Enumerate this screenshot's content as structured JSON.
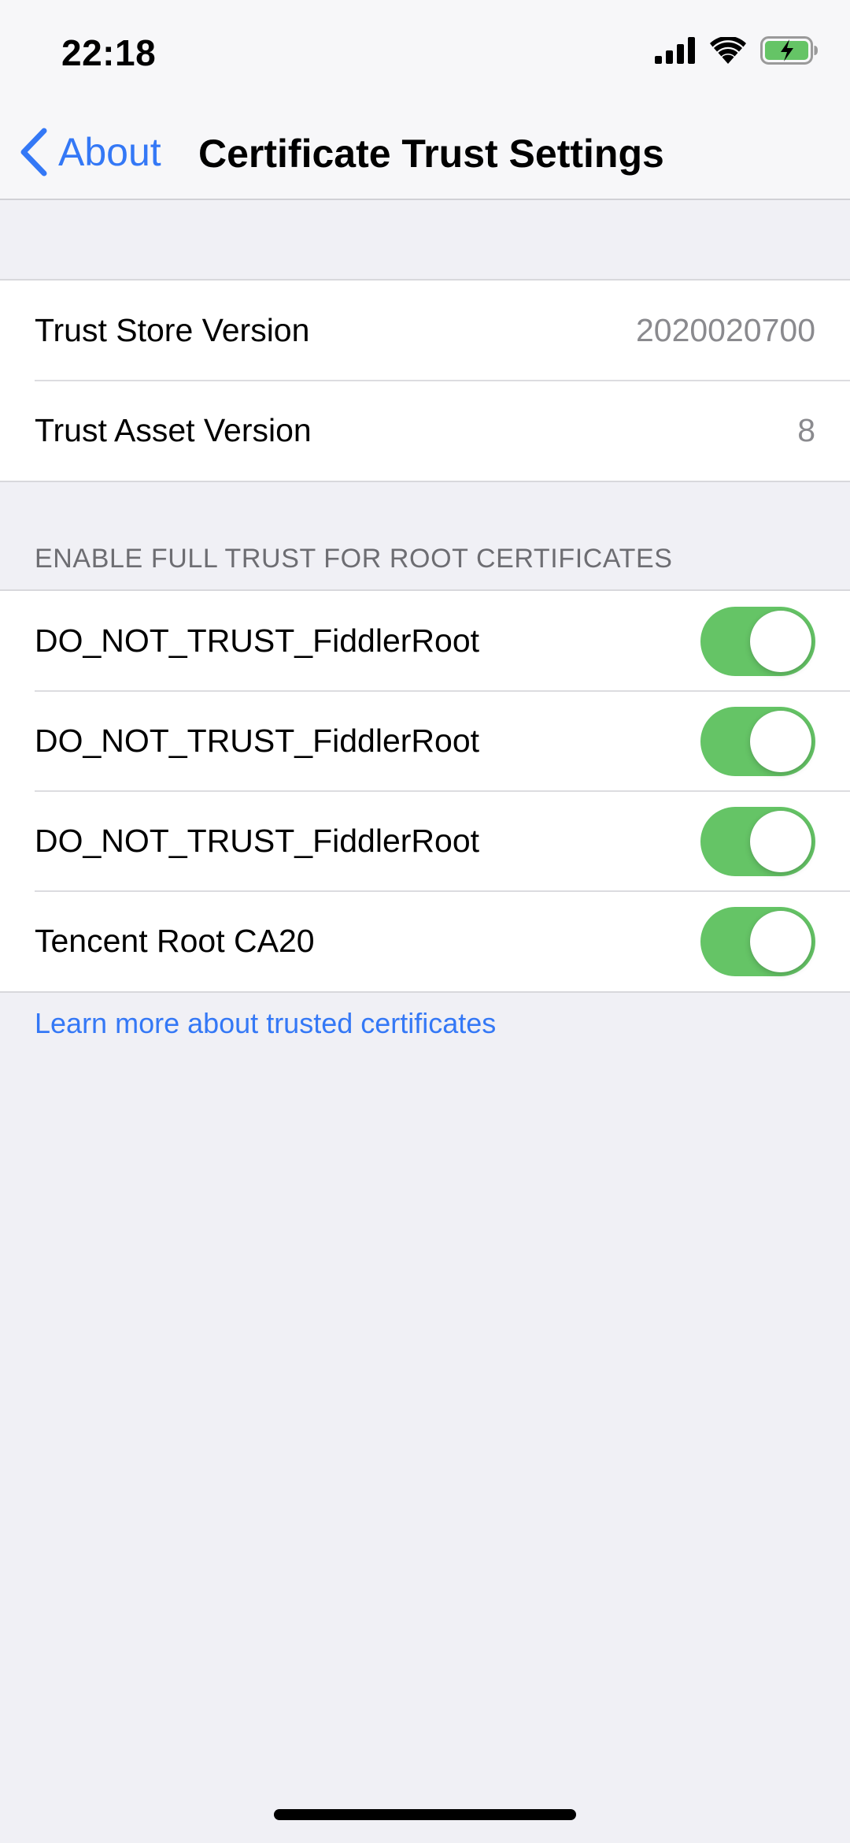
{
  "status_bar": {
    "time": "22:18",
    "icons": [
      "cellular-signal-icon",
      "wifi-icon",
      "battery-charging-icon"
    ]
  },
  "nav": {
    "back_label": "About",
    "title": "Certificate Trust Settings"
  },
  "versions": {
    "trust_store_label": "Trust Store Version",
    "trust_store_value": "2020020700",
    "trust_asset_label": "Trust Asset Version",
    "trust_asset_value": "8"
  },
  "certs_section": {
    "header": "ENABLE FULL TRUST FOR ROOT CERTIFICATES",
    "items": [
      {
        "label": "DO_NOT_TRUST_FiddlerRoot",
        "enabled": true
      },
      {
        "label": "DO_NOT_TRUST_FiddlerRoot",
        "enabled": true
      },
      {
        "label": "DO_NOT_TRUST_FiddlerRoot",
        "enabled": true
      },
      {
        "label": "Tencent Root CA20",
        "enabled": true
      }
    ]
  },
  "footer": {
    "link_text": "Learn more about trusted certificates"
  },
  "colors": {
    "accent": "#3478f6",
    "toggle_on": "#65c466",
    "background": "#f0f0f5",
    "secondary_text": "#8a8a8e",
    "section_header_text": "#6d6d72"
  }
}
